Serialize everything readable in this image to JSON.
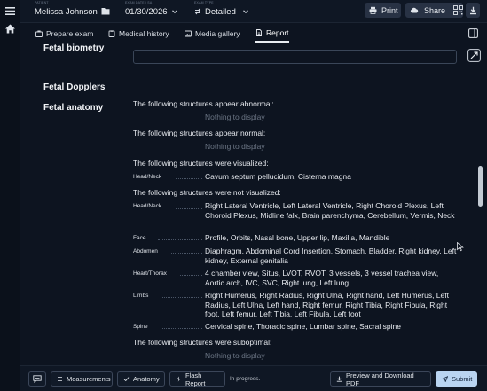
{
  "header": {
    "patient_label": "PATIENT",
    "patient_name": "Melissa Johnson",
    "exam_date_label": "EXAM DATE / SA",
    "exam_date": "01/30/2026",
    "exam_type_label": "EXAM TYPE",
    "exam_type": "Detailed",
    "print_label": "Print",
    "share_label": "Share"
  },
  "tabs": [
    {
      "label": "Prepare exam",
      "icon": "briefcase-icon"
    },
    {
      "label": "Medical history",
      "icon": "clipboard-icon"
    },
    {
      "label": "Media gallery",
      "icon": "image-icon"
    },
    {
      "label": "Report",
      "icon": "document-icon",
      "active": true
    }
  ],
  "report": {
    "fetal_biometry": "Fetal biometry",
    "fetal_dopplers": "Fetal Dopplers",
    "fetal_anatomy": "Fetal anatomy",
    "abnormal_heading": "The following structures appear abnormal:",
    "abnormal_empty": "Nothing to display",
    "normal_heading": "The following structures appear normal:",
    "normal_empty": "Nothing to display",
    "visualized_heading": "The following structures were visualized:",
    "visualized": [
      {
        "region": "Head/Neck",
        "structures": "Cavum septum pellucidum,  Cisterna magna"
      }
    ],
    "not_visualized_heading": "The following structures were not visualized:",
    "not_visualized": [
      {
        "region": "Head/Neck",
        "structures": "Right Lateral Ventricle,  Left Lateral Ventricle,  Right Choroid Plexus,  Left Choroid Plexus,  Midline falx,  Brain parenchyma,  Cerebellum,  Vermis,  Neck"
      },
      {
        "region": "Face",
        "structures": "Profile,  Orbits,  Nasal bone,  Upper lip,  Maxilla,  Mandible"
      },
      {
        "region": "Abdomen",
        "structures": "Diaphragm,  Abdominal Cord Insertion,  Stomach,  Bladder,  Right kidney,  Left kidney,  External genitalia"
      },
      {
        "region": "Heart/Thorax",
        "structures": "4 chamber view,  Situs,  LVOT,  RVOT,  3 vessels,  3 vessel trachea view,  Aortic arch,  IVC,  SVC,  Right lung,  Left lung"
      },
      {
        "region": "Limbs",
        "structures": "Right Humerus,  Right Radius,  Right Ulna,  Right hand,  Left Humerus,  Left Radius,  Left Ulna,  Left hand,  Right femur,  Right Tibia,  Right Fibula,  Right foot,  Left femur,  Left Tibia,  Left Fibula,  Left foot"
      },
      {
        "region": "Spine",
        "structures": "Cervical spine,  Thoracic spine,  Lumbar spine,  Sacral spine"
      }
    ],
    "suboptimal_heading": "The following structures were suboptimal:",
    "suboptimal_empty": "Nothing to display"
  },
  "footer": {
    "measurements_label": "Measurements",
    "anatomy_label": "Anatomy",
    "flash_report_label": "Flash Report",
    "status_text": "In progress.",
    "preview_label": "Preview and Download PDF",
    "submit_label": "Submit"
  }
}
